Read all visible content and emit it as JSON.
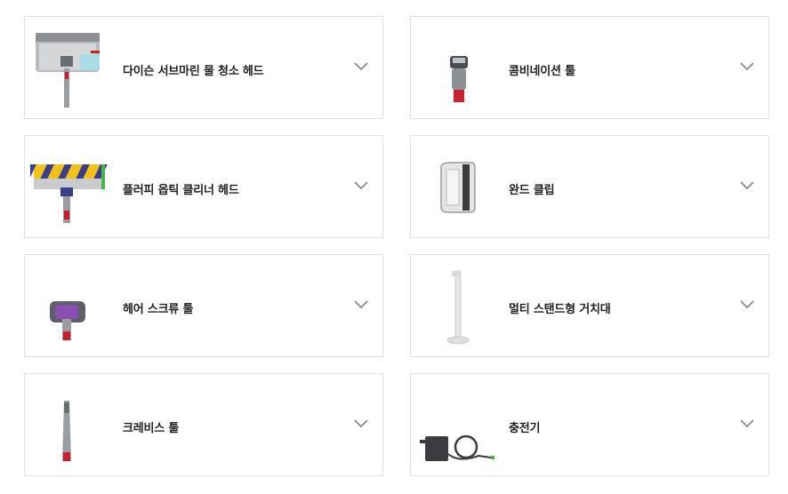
{
  "accessories": [
    {
      "label": "다이슨 서브마린 물 청소 헤드",
      "icon": "submarine-wet-head-icon"
    },
    {
      "label": "콤비네이션 툴",
      "icon": "combination-tool-icon"
    },
    {
      "label": "플러피 옵틱 클리너 헤드",
      "icon": "fluffy-optic-cleaner-head-icon"
    },
    {
      "label": "완드 클립",
      "icon": "wand-clip-icon"
    },
    {
      "label": "헤어 스크류 툴",
      "icon": "hair-screw-tool-icon"
    },
    {
      "label": "멀티 스탠드형 거치대",
      "icon": "floor-dock-stand-icon"
    },
    {
      "label": "크레비스 툴",
      "icon": "crevice-tool-icon"
    },
    {
      "label": "충전기",
      "icon": "charger-icon"
    }
  ],
  "expand_icon": "chevron-down-icon",
  "colors": {
    "accent_red": "#c8202f",
    "border": "#e3e3e3",
    "chevron": "#8c8c8c"
  }
}
